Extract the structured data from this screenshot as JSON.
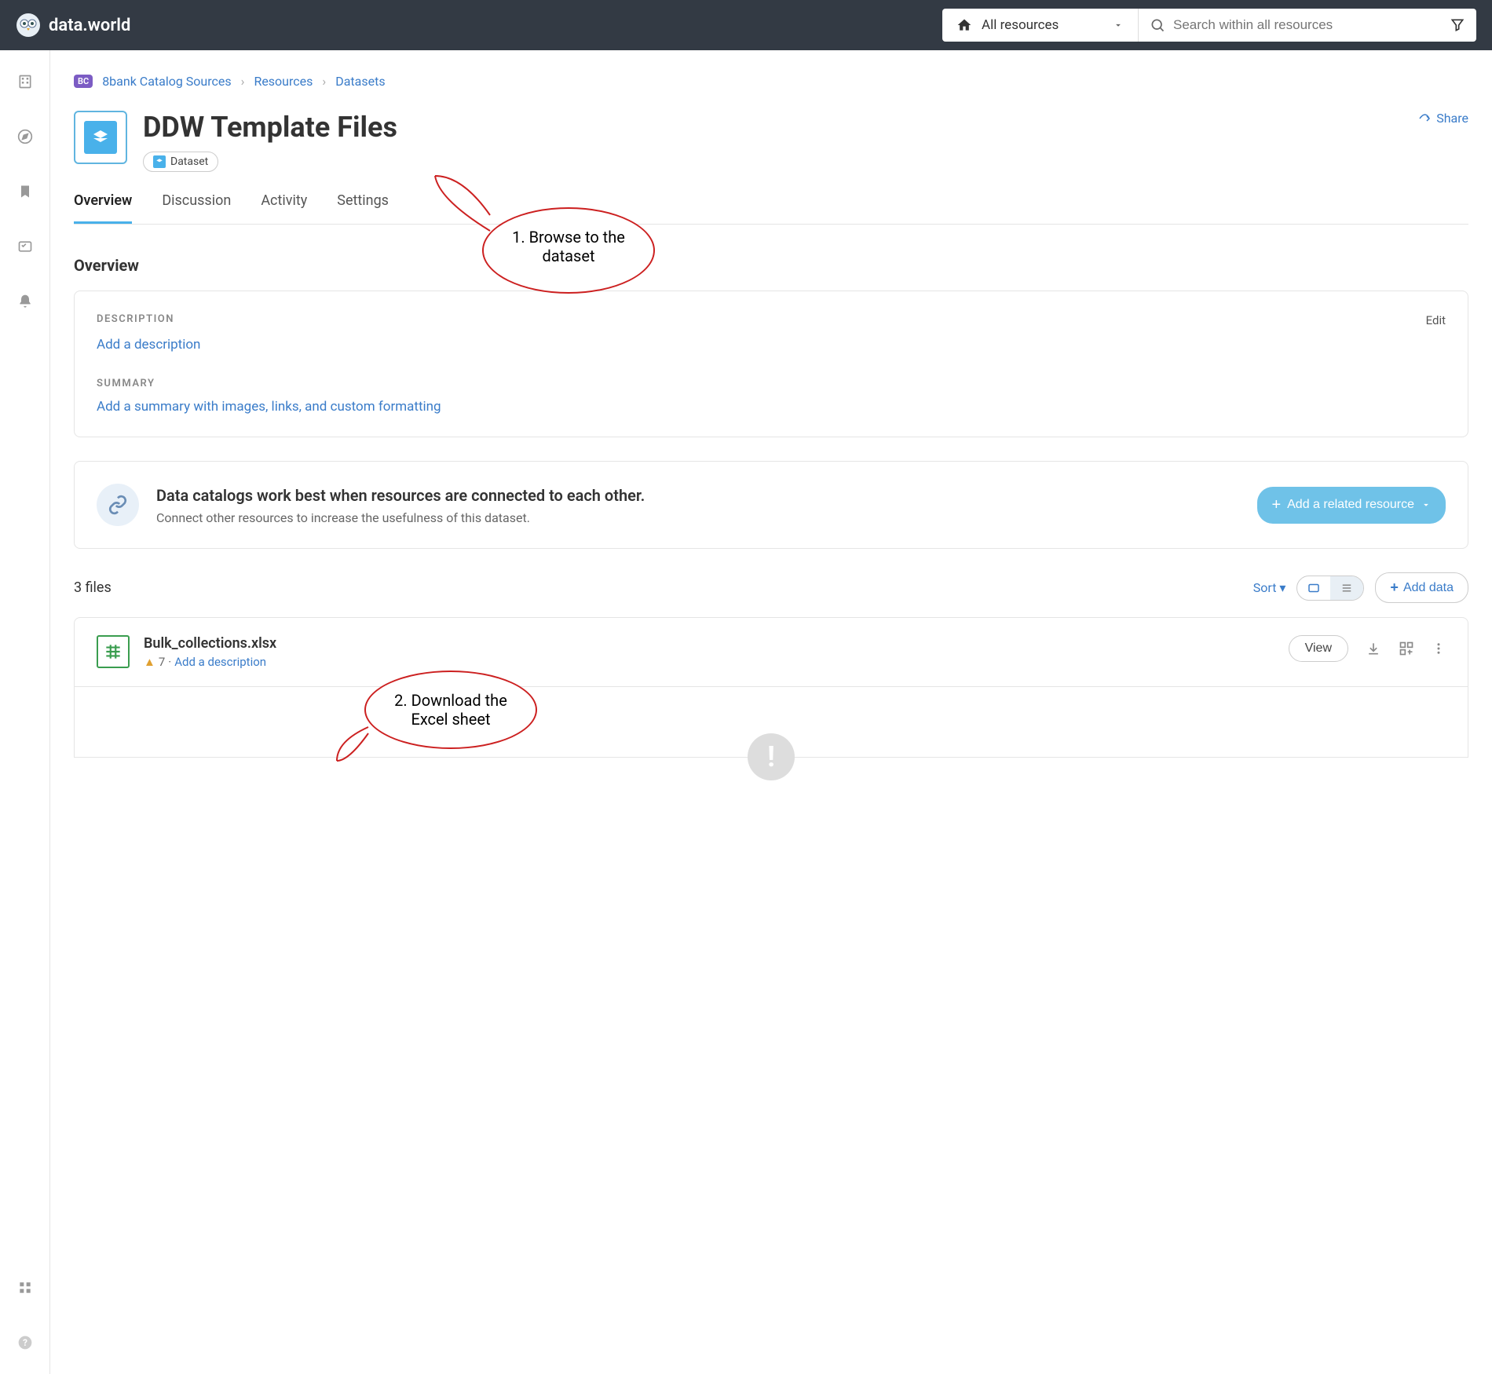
{
  "brand": "data.world",
  "topbar": {
    "resource_selector": "All resources",
    "search_placeholder": "Search within all resources"
  },
  "breadcrumb": {
    "badge": "BC",
    "item1": "8bank Catalog Sources",
    "item2": "Resources",
    "item3": "Datasets"
  },
  "page_title": "DDW Template Files",
  "type_badge": "Dataset",
  "share_label": "Share",
  "tabs": {
    "overview": "Overview",
    "discussion": "Discussion",
    "activity": "Activity",
    "settings": "Settings"
  },
  "section_overview": "Overview",
  "description": {
    "label": "DESCRIPTION",
    "edit": "Edit",
    "placeholder": "Add a description"
  },
  "summary": {
    "label": "SUMMARY",
    "placeholder": "Add a summary with images, links, and custom formatting"
  },
  "related": {
    "title": "Data catalogs work best when resources are connected to each other.",
    "subtitle": "Connect other resources to increase the usefulness of this dataset.",
    "button": "Add a related resource"
  },
  "files": {
    "count": "3 files",
    "sort": "Sort",
    "add_data": "Add data"
  },
  "file1": {
    "name": "Bulk_collections.xlsx",
    "warn_count": "7",
    "add_desc": "Add a description",
    "view": "View"
  },
  "annotations": {
    "a1": "1. Browse to the dataset",
    "a2": "2. Download the Excel sheet"
  }
}
